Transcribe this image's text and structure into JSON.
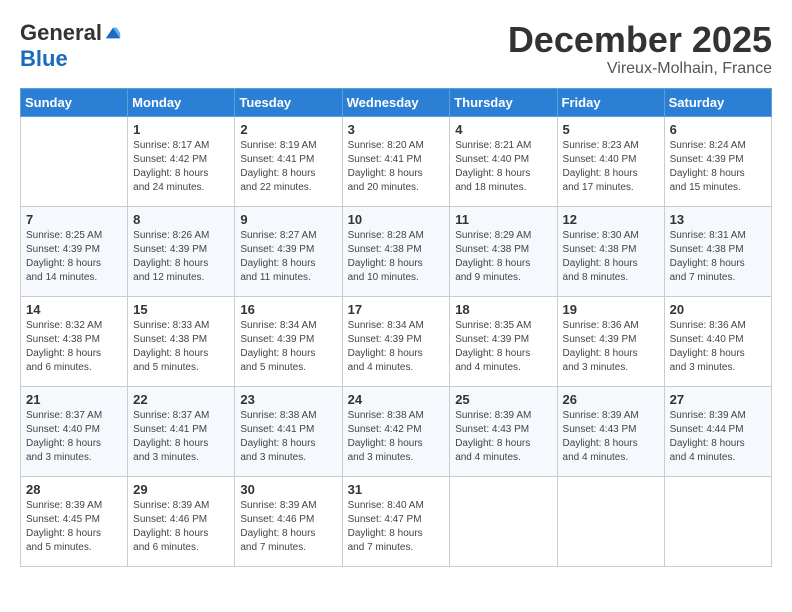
{
  "logo": {
    "general": "General",
    "blue": "Blue"
  },
  "title": "December 2025",
  "subtitle": "Vireux-Molhain, France",
  "header_days": [
    "Sunday",
    "Monday",
    "Tuesday",
    "Wednesday",
    "Thursday",
    "Friday",
    "Saturday"
  ],
  "weeks": [
    [
      {
        "day": "",
        "info": ""
      },
      {
        "day": "1",
        "info": "Sunrise: 8:17 AM\nSunset: 4:42 PM\nDaylight: 8 hours\nand 24 minutes."
      },
      {
        "day": "2",
        "info": "Sunrise: 8:19 AM\nSunset: 4:41 PM\nDaylight: 8 hours\nand 22 minutes."
      },
      {
        "day": "3",
        "info": "Sunrise: 8:20 AM\nSunset: 4:41 PM\nDaylight: 8 hours\nand 20 minutes."
      },
      {
        "day": "4",
        "info": "Sunrise: 8:21 AM\nSunset: 4:40 PM\nDaylight: 8 hours\nand 18 minutes."
      },
      {
        "day": "5",
        "info": "Sunrise: 8:23 AM\nSunset: 4:40 PM\nDaylight: 8 hours\nand 17 minutes."
      },
      {
        "day": "6",
        "info": "Sunrise: 8:24 AM\nSunset: 4:39 PM\nDaylight: 8 hours\nand 15 minutes."
      }
    ],
    [
      {
        "day": "7",
        "info": "Sunrise: 8:25 AM\nSunset: 4:39 PM\nDaylight: 8 hours\nand 14 minutes."
      },
      {
        "day": "8",
        "info": "Sunrise: 8:26 AM\nSunset: 4:39 PM\nDaylight: 8 hours\nand 12 minutes."
      },
      {
        "day": "9",
        "info": "Sunrise: 8:27 AM\nSunset: 4:39 PM\nDaylight: 8 hours\nand 11 minutes."
      },
      {
        "day": "10",
        "info": "Sunrise: 8:28 AM\nSunset: 4:38 PM\nDaylight: 8 hours\nand 10 minutes."
      },
      {
        "day": "11",
        "info": "Sunrise: 8:29 AM\nSunset: 4:38 PM\nDaylight: 8 hours\nand 9 minutes."
      },
      {
        "day": "12",
        "info": "Sunrise: 8:30 AM\nSunset: 4:38 PM\nDaylight: 8 hours\nand 8 minutes."
      },
      {
        "day": "13",
        "info": "Sunrise: 8:31 AM\nSunset: 4:38 PM\nDaylight: 8 hours\nand 7 minutes."
      }
    ],
    [
      {
        "day": "14",
        "info": "Sunrise: 8:32 AM\nSunset: 4:38 PM\nDaylight: 8 hours\nand 6 minutes."
      },
      {
        "day": "15",
        "info": "Sunrise: 8:33 AM\nSunset: 4:38 PM\nDaylight: 8 hours\nand 5 minutes."
      },
      {
        "day": "16",
        "info": "Sunrise: 8:34 AM\nSunset: 4:39 PM\nDaylight: 8 hours\nand 5 minutes."
      },
      {
        "day": "17",
        "info": "Sunrise: 8:34 AM\nSunset: 4:39 PM\nDaylight: 8 hours\nand 4 minutes."
      },
      {
        "day": "18",
        "info": "Sunrise: 8:35 AM\nSunset: 4:39 PM\nDaylight: 8 hours\nand 4 minutes."
      },
      {
        "day": "19",
        "info": "Sunrise: 8:36 AM\nSunset: 4:39 PM\nDaylight: 8 hours\nand 3 minutes."
      },
      {
        "day": "20",
        "info": "Sunrise: 8:36 AM\nSunset: 4:40 PM\nDaylight: 8 hours\nand 3 minutes."
      }
    ],
    [
      {
        "day": "21",
        "info": "Sunrise: 8:37 AM\nSunset: 4:40 PM\nDaylight: 8 hours\nand 3 minutes."
      },
      {
        "day": "22",
        "info": "Sunrise: 8:37 AM\nSunset: 4:41 PM\nDaylight: 8 hours\nand 3 minutes."
      },
      {
        "day": "23",
        "info": "Sunrise: 8:38 AM\nSunset: 4:41 PM\nDaylight: 8 hours\nand 3 minutes."
      },
      {
        "day": "24",
        "info": "Sunrise: 8:38 AM\nSunset: 4:42 PM\nDaylight: 8 hours\nand 3 minutes."
      },
      {
        "day": "25",
        "info": "Sunrise: 8:39 AM\nSunset: 4:43 PM\nDaylight: 8 hours\nand 4 minutes."
      },
      {
        "day": "26",
        "info": "Sunrise: 8:39 AM\nSunset: 4:43 PM\nDaylight: 8 hours\nand 4 minutes."
      },
      {
        "day": "27",
        "info": "Sunrise: 8:39 AM\nSunset: 4:44 PM\nDaylight: 8 hours\nand 4 minutes."
      }
    ],
    [
      {
        "day": "28",
        "info": "Sunrise: 8:39 AM\nSunset: 4:45 PM\nDaylight: 8 hours\nand 5 minutes."
      },
      {
        "day": "29",
        "info": "Sunrise: 8:39 AM\nSunset: 4:46 PM\nDaylight: 8 hours\nand 6 minutes."
      },
      {
        "day": "30",
        "info": "Sunrise: 8:39 AM\nSunset: 4:46 PM\nDaylight: 8 hours\nand 7 minutes."
      },
      {
        "day": "31",
        "info": "Sunrise: 8:40 AM\nSunset: 4:47 PM\nDaylight: 8 hours\nand 7 minutes."
      },
      {
        "day": "",
        "info": ""
      },
      {
        "day": "",
        "info": ""
      },
      {
        "day": "",
        "info": ""
      }
    ]
  ]
}
